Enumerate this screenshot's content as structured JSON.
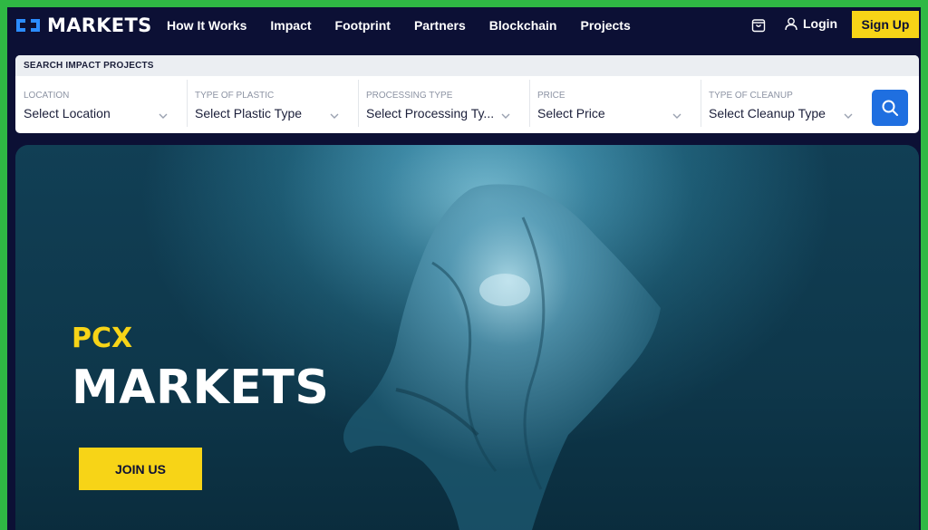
{
  "brand": {
    "logo_text": "MARKETS"
  },
  "nav": {
    "links": [
      "How It Works",
      "Impact",
      "Footprint",
      "Partners",
      "Blockchain",
      "Projects"
    ],
    "cart_icon": "shopping-bag-icon",
    "login_label": "Login",
    "login_icon": "user-icon",
    "signup_label": "Sign Up"
  },
  "search": {
    "title": "SEARCH IMPACT PROJECTS",
    "filters": [
      {
        "label": "LOCATION",
        "value": "Select Location"
      },
      {
        "label": "TYPE OF PLASTIC",
        "value": "Select Plastic Type"
      },
      {
        "label": "PROCESSING TYPE",
        "value": "Select Processing Ty..."
      },
      {
        "label": "PRICE",
        "value": "Select Price"
      },
      {
        "label": "TYPE OF CLEANUP",
        "value": "Select Cleanup Type"
      }
    ],
    "button_icon": "search-icon"
  },
  "hero": {
    "pre_title": "PCX",
    "title": "MARKETS",
    "cta_label": "JOIN US"
  },
  "colors": {
    "frame_border": "#2fb844",
    "nav_bg": "#0c1035",
    "accent_yellow": "#f7d417",
    "search_button": "#1f6fe0"
  }
}
